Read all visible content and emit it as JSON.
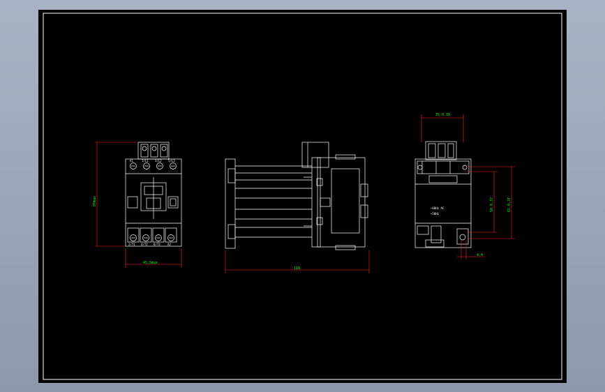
{
  "drawing": {
    "front_view": {
      "terminals_top": [
        "A1",
        "1/L1",
        "3/L2",
        "5/L3"
      ],
      "terminals_bottom": [
        "2/T1",
        "4/T2",
        "6/T3",
        "A2"
      ],
      "dim_height": "87max",
      "dim_width": "45.5max"
    },
    "side_view": {
      "dim_length": "118"
    },
    "mount_view": {
      "dim_top": "35 0.39",
      "dim_vertical_a": "50 0.37",
      "dim_vertical_b": "65 0.37",
      "dim_bottom": "4.4",
      "label_line1": "~60Hz  AC",
      "label_line2": "~50Hz"
    },
    "colors": {
      "outline": "#ffffff",
      "dimension": "#00ff00",
      "dimension_line": "#ff2020",
      "background": "#000000"
    }
  }
}
